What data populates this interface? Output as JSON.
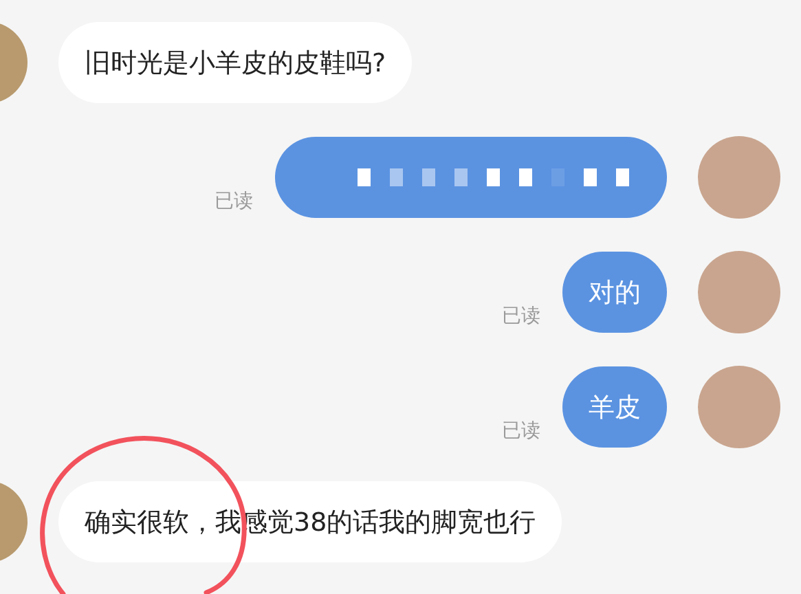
{
  "messages": [
    {
      "outgoing": false,
      "kind": "text",
      "text": "旧时光是小羊皮的皮鞋吗?"
    },
    {
      "outgoing": true,
      "kind": "redacted",
      "status": "已读"
    },
    {
      "outgoing": true,
      "kind": "text",
      "text": "对的",
      "status": "已读"
    },
    {
      "outgoing": true,
      "kind": "text",
      "text": "羊皮",
      "status": "已读"
    },
    {
      "outgoing": false,
      "kind": "text",
      "text": "确实很软，我感觉38的话我的脚宽也行"
    }
  ]
}
